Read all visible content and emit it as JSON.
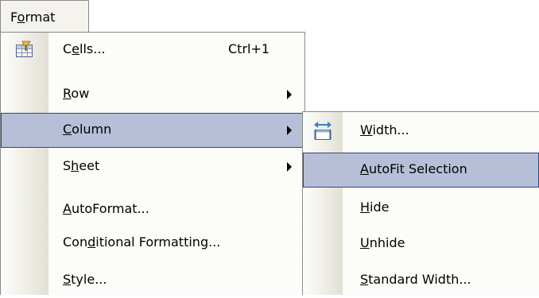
{
  "menubar": {
    "title_pre": "F",
    "title_acc": "o",
    "title_post": "rmat"
  },
  "menu": {
    "items": [
      {
        "pre": "C",
        "acc": "e",
        "post": "lls...",
        "shortcut": "Ctrl+1",
        "icon": "format-cells-icon"
      },
      {
        "pre": "",
        "acc": "R",
        "post": "ow",
        "submenu": true
      },
      {
        "pre": "",
        "acc": "C",
        "post": "olumn",
        "submenu": true,
        "highlighted": true
      },
      {
        "pre": "S",
        "acc": "h",
        "post": "eet",
        "submenu": true
      },
      {
        "pre": "",
        "acc": "A",
        "post": "utoFormat..."
      },
      {
        "pre": "Con",
        "acc": "d",
        "post": "itional Formatting..."
      },
      {
        "pre": "",
        "acc": "S",
        "post": "tyle..."
      }
    ]
  },
  "submenu": {
    "items": [
      {
        "pre": "",
        "acc": "W",
        "post": "idth...",
        "icon": "column-width-icon"
      },
      {
        "pre": "",
        "acc": "A",
        "post": "utoFit Selection",
        "highlighted": true
      },
      {
        "pre": "",
        "acc": "H",
        "post": "ide"
      },
      {
        "pre": "",
        "acc": "U",
        "post": "nhide"
      },
      {
        "pre": "",
        "acc": "S",
        "post": "tandard Width..."
      }
    ]
  },
  "colors": {
    "highlight_fill": "#b7bed8",
    "highlight_border": "#324876",
    "menu_bg": "#fcfcf9"
  }
}
